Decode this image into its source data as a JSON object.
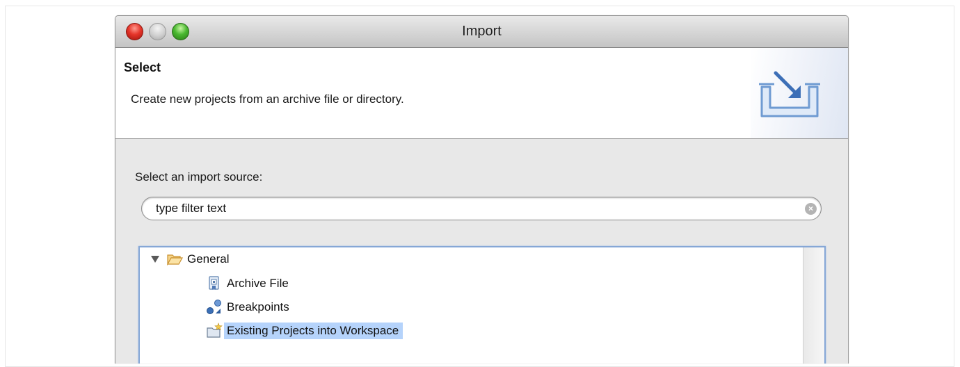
{
  "window": {
    "title": "Import",
    "traffic_lights": [
      "close",
      "minimize",
      "zoom"
    ]
  },
  "banner": {
    "title": "Select",
    "description": "Create new projects from an archive file or directory.",
    "icon": "import-wizard-icon"
  },
  "source": {
    "label": "Select an import source:",
    "filter_placeholder": "type filter text",
    "filter_value": ""
  },
  "tree": {
    "items": [
      {
        "label": "General",
        "icon": "folder-open-icon",
        "expanded": true,
        "level": 0
      },
      {
        "label": "Archive File",
        "icon": "archive-file-icon",
        "level": 1
      },
      {
        "label": "Breakpoints",
        "icon": "breakpoints-icon",
        "level": 1
      },
      {
        "label": "Existing Projects into Workspace",
        "icon": "existing-projects-icon",
        "level": 1,
        "selected": true
      }
    ]
  },
  "colors": {
    "selection": "#b5d3fb",
    "focus_border": "#86a7d6"
  }
}
